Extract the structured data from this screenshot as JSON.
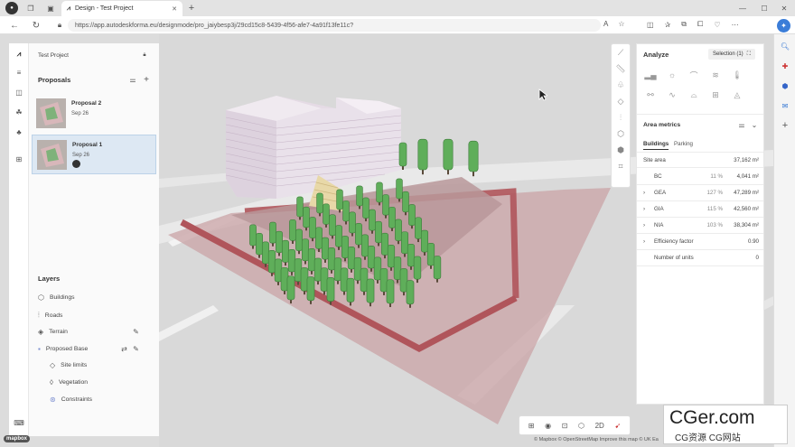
{
  "browser": {
    "tab_title": "Design - Test Project",
    "url": "https://app.autodeskforma.eu/designmode/pro_jaiybesp3j/29cd15c8-5439-4f56-afe7-4a91f13fe11c?"
  },
  "left_panel": {
    "project_name": "Test Project",
    "proposals_title": "Proposals",
    "proposals": [
      {
        "name": "Proposal 2",
        "date": "Sep 26",
        "selected": false
      },
      {
        "name": "Proposal 1",
        "date": "Sep 26",
        "selected": true
      }
    ],
    "layers_title": "Layers",
    "layers": [
      {
        "label": "Buildings",
        "icon": "cube-icon",
        "indent": false
      },
      {
        "label": "Roads",
        "icon": "road-icon",
        "indent": false
      },
      {
        "label": "Terrain",
        "icon": "terrain-icon",
        "indent": false
      },
      {
        "label": "Proposed Base",
        "icon": "base-icon",
        "indent": false
      },
      {
        "label": "Site limits",
        "icon": "site-limits-icon",
        "indent": true
      },
      {
        "label": "Vegetation",
        "icon": "leaf-icon",
        "indent": true
      },
      {
        "label": "Constraints",
        "icon": "constraints-icon",
        "indent": true
      }
    ]
  },
  "right_panel": {
    "analyze_title": "Analyze",
    "selection_label": "Selection (1)",
    "area_metrics_title": "Area metrics",
    "tabs": [
      "Buildings",
      "Parking"
    ],
    "site_area_label": "Site area",
    "site_area_value": "37,162 m²",
    "metrics": [
      {
        "label": "BC",
        "pct": "11 %",
        "value": "4,041 m²",
        "expandable": false
      },
      {
        "label": "GEA",
        "pct": "127 %",
        "value": "47,289 m²",
        "expandable": true
      },
      {
        "label": "GIA",
        "pct": "115 %",
        "value": "42,560 m²",
        "expandable": true
      },
      {
        "label": "NIA",
        "pct": "103 %",
        "value": "38,304 m²",
        "expandable": true
      },
      {
        "label": "Efficiency factor",
        "pct": "",
        "value": "0.90",
        "expandable": true
      },
      {
        "label": "Number of units",
        "pct": "",
        "value": "0",
        "expandable": false
      }
    ]
  },
  "bottom_toolbar": {
    "view_2d": "2D"
  },
  "attribution": "© Mapbox  © OpenStreetMap  Improve this map  © UK Ea",
  "mapbox_logo": "mapbox",
  "watermark": {
    "line1": "CGer.com",
    "line2": "CG资源 CG网站"
  },
  "colors": {
    "accent": "#1a73c8",
    "selected_card": "#dde8f3",
    "trees": "#5fae5a",
    "site_red": "#c96a6d",
    "building": "#e2d9e2"
  }
}
